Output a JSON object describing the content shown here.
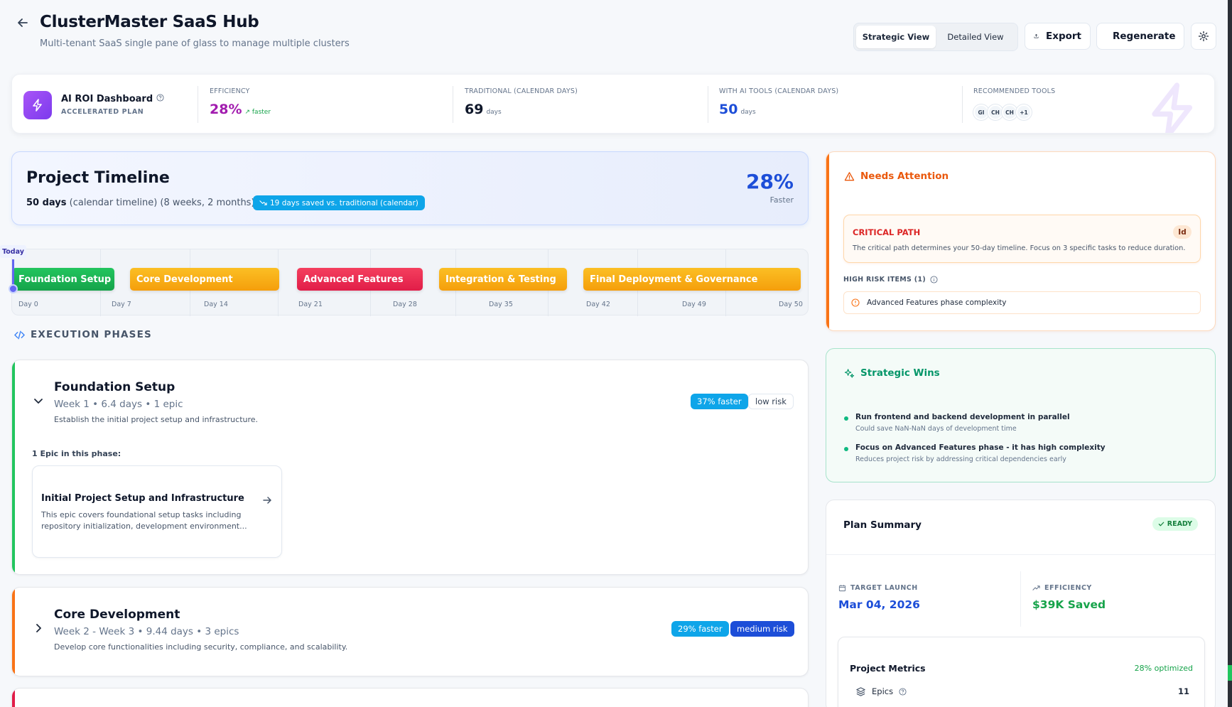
{
  "header": {
    "title": "ClusterMaster SaaS Hub",
    "subtitle": "Multi-tenant SaaS single pane of glass to manage multiple clusters",
    "view_toggle": [
      "Strategic View",
      "Detailed View"
    ],
    "export_label": "Export",
    "regenerate_label": "Regenerate"
  },
  "roi": {
    "title": "AI ROI Dashboard",
    "plan": "ACCELERATED PLAN",
    "efficiency_label": "EFFICIENCY",
    "efficiency_value": "28%",
    "efficiency_trend": "faster",
    "traditional_label": "TRADITIONAL (CALENDAR DAYS)",
    "traditional_value": "69",
    "traditional_unit": "days",
    "ai_label": "WITH AI TOOLS (CALENDAR DAYS)",
    "ai_value": "50",
    "ai_unit": "days",
    "tools_label": "RECOMMENDED TOOLS",
    "tools": [
      "GI",
      "CH",
      "CH",
      "+1"
    ]
  },
  "timeline": {
    "title": "Project Timeline",
    "days_bold": "50 days",
    "days_rest": " (calendar timeline) (8 weeks, 2 months)",
    "badge": "19 days saved vs. traditional (calendar)",
    "pct": "28%",
    "pct_label": "Faster"
  },
  "gantt": {
    "today": "Today",
    "bars": [
      {
        "label": "Foundation Setup",
        "color": "green"
      },
      {
        "label": "Core Development",
        "color": "orange"
      },
      {
        "label": "Advanced Features",
        "color": "red"
      },
      {
        "label": "Integration & Testing",
        "color": "orange"
      },
      {
        "label": "Final Deployment & Governance",
        "color": "orange"
      }
    ],
    "days": [
      "Day 0",
      "Day 7",
      "Day 14",
      "Day 21",
      "Day 28",
      "Day 35",
      "Day 42",
      "Day 49",
      "Day 50"
    ]
  },
  "exec": {
    "label": "EXECUTION PHASES",
    "phases": [
      {
        "title": "Foundation Setup",
        "meta": "Week 1 • 6.4 days • 1 epic",
        "desc": "Establish the initial project setup and infrastructure.",
        "speed": "37% faster",
        "risk": "low risk",
        "epic_count": "1 Epic in this phase:",
        "epic_title": "Initial Project Setup and Infrastructure",
        "epic_desc": "This epic covers foundational setup tasks including repository initialization, development environment..."
      },
      {
        "title": "Core Development",
        "meta": "Week 2 - Week 3 • 9.44 days • 3 epics",
        "desc": "Develop core functionalities including security, compliance, and scalability.",
        "speed": "29% faster",
        "risk": "medium risk"
      }
    ]
  },
  "attention": {
    "title": "Needs Attention",
    "critical_title": "CRITICAL PATH",
    "critical_id": "Id",
    "critical_desc": "The critical path determines your 50-day timeline. Focus on 3 specific tasks to reduce duration.",
    "high_risk_label": "HIGH RISK ITEMS (1)",
    "risk_item": "Advanced Features phase complexity"
  },
  "wins": {
    "title": "Strategic Wins",
    "items": [
      {
        "title": "Run frontend and backend development in parallel",
        "sub": "Could save NaN-NaN days of development time"
      },
      {
        "title": "Focus on Advanced Features phase - it has high complexity",
        "sub": "Reduces project risk by addressing critical dependencies early"
      }
    ]
  },
  "summary": {
    "title": "Plan Summary",
    "status": "READY",
    "target_label": "TARGET LAUNCH",
    "target_value": "Mar 04, 2026",
    "efficiency_label": "EFFICIENCY",
    "efficiency_value": "$39K Saved",
    "metrics_title": "Project Metrics",
    "metrics_opt": "28% optimized",
    "epics_label": "Epics",
    "epics_value": "11"
  },
  "colors": {
    "accent": "#7c3aed",
    "primary": "#1d4ed8",
    "sky": "#0ea5e9",
    "green": "#16a34a",
    "orange": "#f97316",
    "red": "#e11d48"
  }
}
